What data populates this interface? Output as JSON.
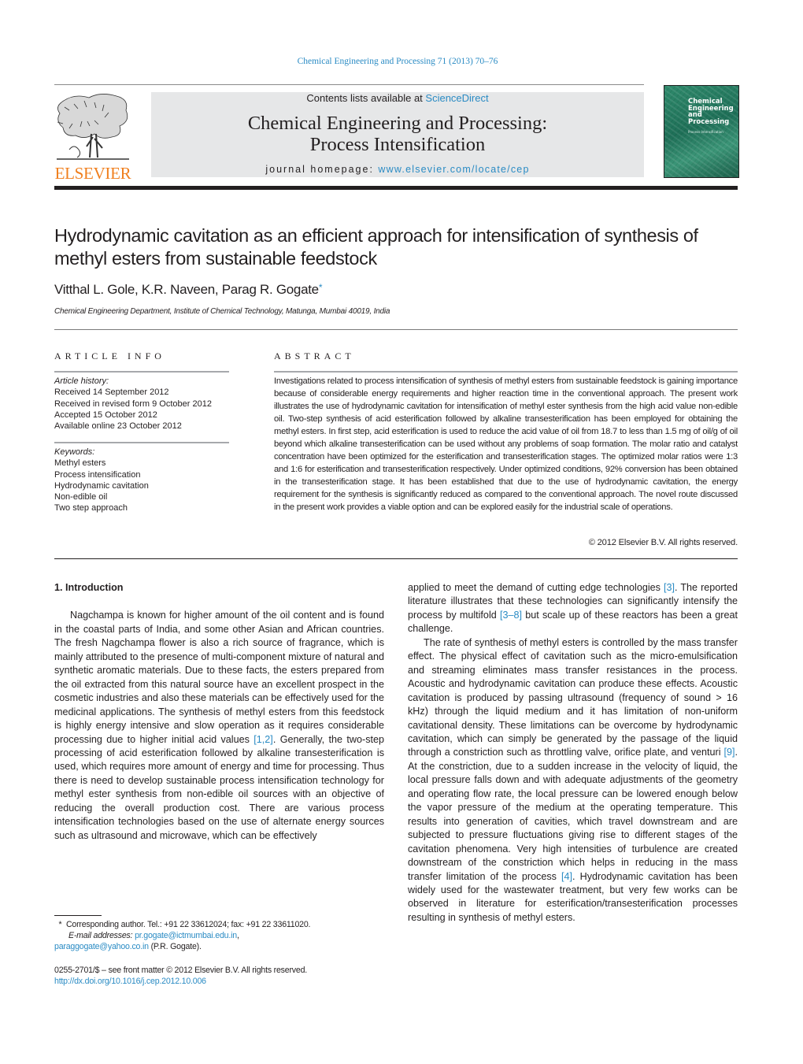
{
  "running_header": {
    "journal_ref": "Chemical Engineering and Processing 71 (2013) 70–76"
  },
  "masthead": {
    "publisher_logo_text": "ELSEVIER",
    "contents_prefix": "Contents lists available at ",
    "contents_link": "ScienceDirect",
    "journal_title_line1": "Chemical Engineering and Processing:",
    "journal_title_line2": "Process Intensification",
    "homepage_prefix": "journal homepage: ",
    "homepage_url": "www.elsevier.com/locate/cep",
    "cover_title_lines": [
      "Chemical",
      "Engineering",
      "and",
      "Processing"
    ],
    "cover_subtitle": "Process Intensification"
  },
  "article": {
    "title": "Hydrodynamic cavitation as an efficient approach for intensification of synthesis of methyl esters from sustainable feedstock",
    "authors": "Vitthal L. Gole, K.R. Naveen, Parag R. Gogate",
    "corresponding_marker": "*",
    "affiliation": "Chemical Engineering Department, Institute of Chemical Technology, Matunga, Mumbai 40019, India"
  },
  "article_info": {
    "label": "ARTICLE INFO",
    "history_heading": "Article history:",
    "history": [
      "Received 14 September 2012",
      "Received in revised form 9 October 2012",
      "Accepted 15 October 2012",
      "Available online 23 October 2012"
    ],
    "keywords_heading": "Keywords:",
    "keywords": [
      "Methyl esters",
      "Process intensification",
      "Hydrodynamic cavitation",
      "Non-edible oil",
      "Two step approach"
    ]
  },
  "abstract": {
    "label": "ABSTRACT",
    "text": "Investigations related to process intensification of synthesis of methyl esters from sustainable feedstock is gaining importance because of considerable energy requirements and higher reaction time in the conventional approach. The present work illustrates the use of hydrodynamic cavitation for intensification of methyl ester synthesis from the high acid value non-edible oil. Two-step synthesis of acid esterification followed by alkaline transesterification has been employed for obtaining the methyl esters. In first step, acid esterification is used to reduce the acid value of oil from 18.7 to less than 1.5 mg of oil/g of oil beyond which alkaline transesterification can be used without any problems of soap formation. The molar ratio and catalyst concentration have been optimized for the esterification and transesterification stages. The optimized molar ratios were 1:3 and 1:6 for esterification and transesterification respectively. Under optimized conditions, 92% conversion has been obtained in the transesterification stage. It has been established that due to the use of hydrodynamic cavitation, the energy requirement for the synthesis is significantly reduced as compared to the conventional approach. The novel route discussed in the present work provides a viable option and can be explored easily for the industrial scale of operations.",
    "copyright": "© 2012 Elsevier B.V. All rights reserved."
  },
  "body": {
    "section_heading": "1.  Introduction",
    "left_p1_a": "Nagchampa is known for higher amount of the oil content and is found in the coastal parts of India, and some other Asian and African countries. The fresh Nagchampa flower is also a rich source of fragrance, which is mainly attributed to the presence of multi-component mixture of natural and synthetic aromatic materials. Due to these facts, the esters prepared from the oil extracted from this natural source have an excellent prospect in the cosmetic industries and also these materials can be effectively used for the medicinal applications. The synthesis of methyl esters from this feedstock is highly energy intensive and slow operation as it requires considerable processing due to higher initial acid values ",
    "ref_1_2": "[1,2]",
    "left_p1_b": ". Generally, the two-step processing of acid esterification followed by alkaline transesterification is used, which requires more amount of energy and time for processing. Thus there is need to develop sustainable process intensification technology for methyl ester synthesis from non-edible oil sources with an objective of reducing the overall production cost. There are various process intensification technologies based on the use of alternate energy sources such as ultrasound and microwave, which can be effectively",
    "right_p1_a": "applied to meet the demand of cutting edge technologies ",
    "ref_3": "[3]",
    "right_p1_b": ". The reported literature illustrates that these technologies can significantly intensify the process by multifold ",
    "ref_3_8": "[3–8]",
    "right_p1_c": " but scale up of these reactors has been a great challenge.",
    "right_p2_a": "The rate of synthesis of methyl esters is controlled by the mass transfer effect. The physical effect of cavitation such as the micro-emulsification and streaming eliminates mass transfer resistances in the process. Acoustic and hydrodynamic cavitation can produce these effects. Acoustic cavitation is produced by passing ultrasound (frequency of sound > 16 kHz) through the liquid medium and it has limitation of non-uniform cavitational density. These limitations can be overcome by hydrodynamic cavitation, which can simply be generated by the passage of the liquid through a constriction such as throttling valve, orifice plate, and venturi ",
    "ref_9": "[9]",
    "right_p2_b": ". At the constriction, due to a sudden increase in the velocity of liquid, the local pressure falls down and with adequate adjustments of the geometry and operating flow rate, the local pressure can be lowered enough below the vapor pressure of the medium at the operating temperature. This results into generation of cavities, which travel downstream and are subjected to pressure fluctuations giving rise to different stages of the cavitation phenomena. Very high intensities of turbulence are created downstream of the constriction which helps in reducing in the mass transfer limitation of the process ",
    "ref_4": "[4]",
    "right_p2_c": ". Hydrodynamic cavitation has been widely used for the wastewater treatment, but very few works can be observed in literature for esterification/transesterification processes resulting in synthesis of methyl esters."
  },
  "footnotes": {
    "marker": "*",
    "corresponding": "Corresponding author. Tel.: +91 22 33612024; fax: +91 22 33611020.",
    "email_label": "E-mail addresses: ",
    "email_1": "pr.gogate@ictmumbai.edu.in",
    "email_sep": ",",
    "email_2": "paraggogate@yahoo.co.in",
    "email_owner": " (P.R. Gogate).",
    "front_matter": "0255-2701/$ – see front matter © 2012 Elsevier B.V. All rights reserved.",
    "doi": "http://dx.doi.org/10.1016/j.cep.2012.10.006"
  },
  "colors": {
    "link": "#2a8bc4",
    "elsevier_orange": "#f07f1e",
    "masthead_gray": "#e6e7e8",
    "cover_green": "#2f8a6c"
  }
}
